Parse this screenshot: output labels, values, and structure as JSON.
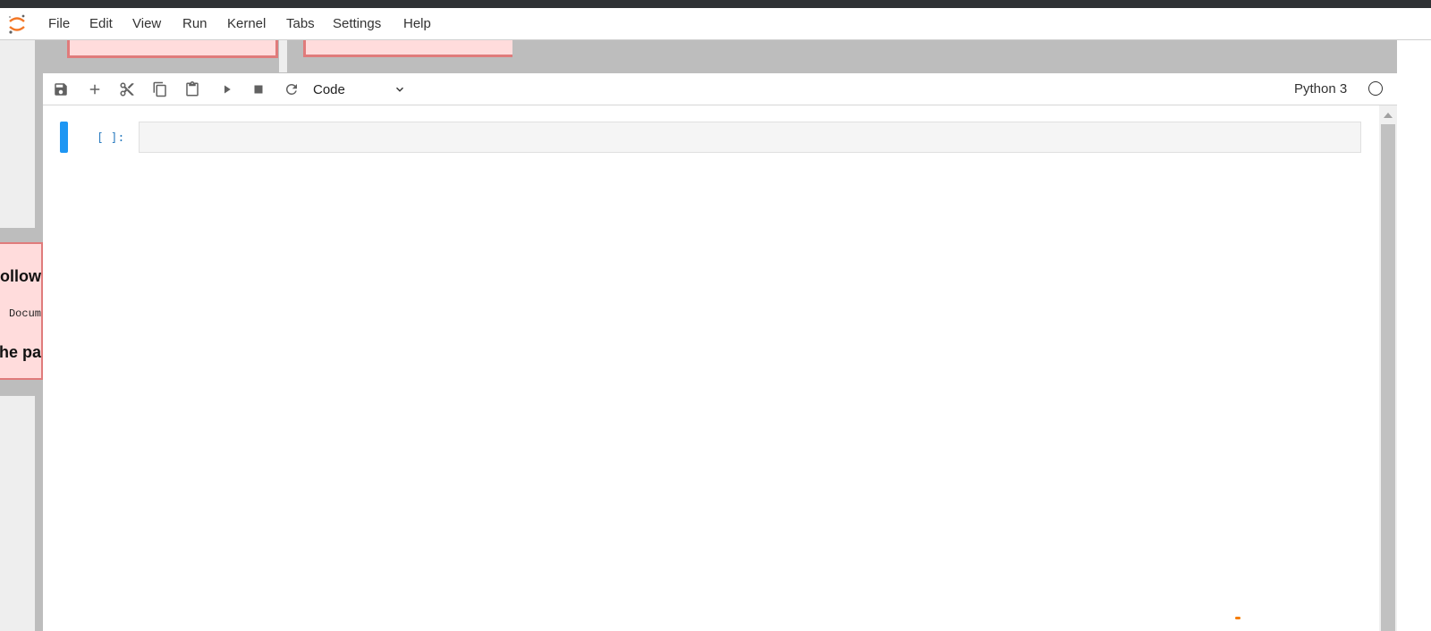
{
  "menubar": {
    "items": [
      "File",
      "Edit",
      "View",
      "Run",
      "Kernel",
      "Tabs",
      "Settings",
      "Help"
    ]
  },
  "left_card": {
    "line1": "ollow",
    "line2": "Docum",
    "line3": "the pa"
  },
  "toolbar": {
    "buttons": [
      "save-icon",
      "add-icon",
      "cut-icon",
      "copy-icon",
      "paste-icon",
      "run-icon",
      "stop-icon",
      "restart-icon"
    ],
    "cell_type": "Code",
    "kernel_name": "Python 3"
  },
  "cell": {
    "prompt": "[ ]:",
    "source": ""
  },
  "colors": {
    "accent": "#1e96f3",
    "prompt": "#307fc1",
    "card_bg": "#ffdcdc",
    "card_border": "#e07b7b",
    "logo": "#f37726"
  }
}
